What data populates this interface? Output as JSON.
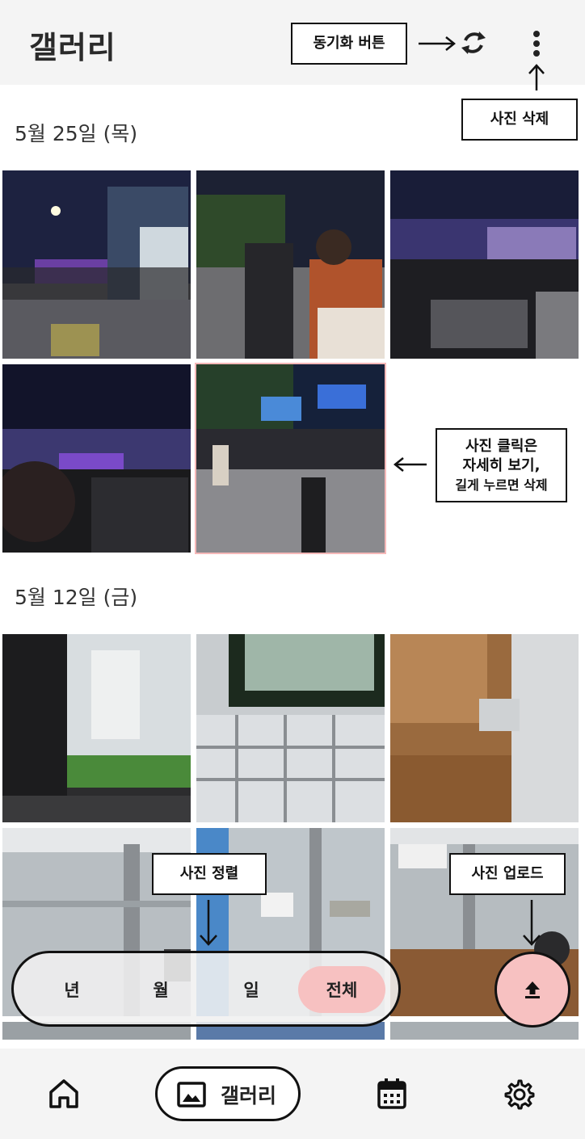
{
  "header": {
    "title": "갤러리",
    "sync_icon": "sync-icon",
    "more_icon": "more-vertical-icon"
  },
  "annotations": {
    "sync": "동기화 버튼",
    "delete": "사진 삭제",
    "photo_click_lines": [
      "사진 클릭은",
      "자세히 보기,",
      "길게 누르면 삭제"
    ],
    "sort": "사진 정렬",
    "upload": "사진 업로드"
  },
  "sections": [
    {
      "date": "5월 25일 (목)",
      "photo_count": 5
    },
    {
      "date": "5월 12일 (금)",
      "photo_count": 9
    }
  ],
  "sort_bar": {
    "options": [
      "년",
      "월",
      "일",
      "전체"
    ],
    "selected": "전체"
  },
  "upload_button": {
    "icon": "upload-icon"
  },
  "bottom_nav": {
    "items": [
      {
        "icon": "home-icon",
        "label": ""
      },
      {
        "icon": "image-icon",
        "label": "갤러리",
        "active": true
      },
      {
        "icon": "calendar-icon",
        "label": ""
      },
      {
        "icon": "settings-icon",
        "label": ""
      }
    ]
  },
  "colors": {
    "accent_pink": "#f7c1c1",
    "selected_outline": "#f5b8b8",
    "header_bg": "#f4f4f4"
  }
}
